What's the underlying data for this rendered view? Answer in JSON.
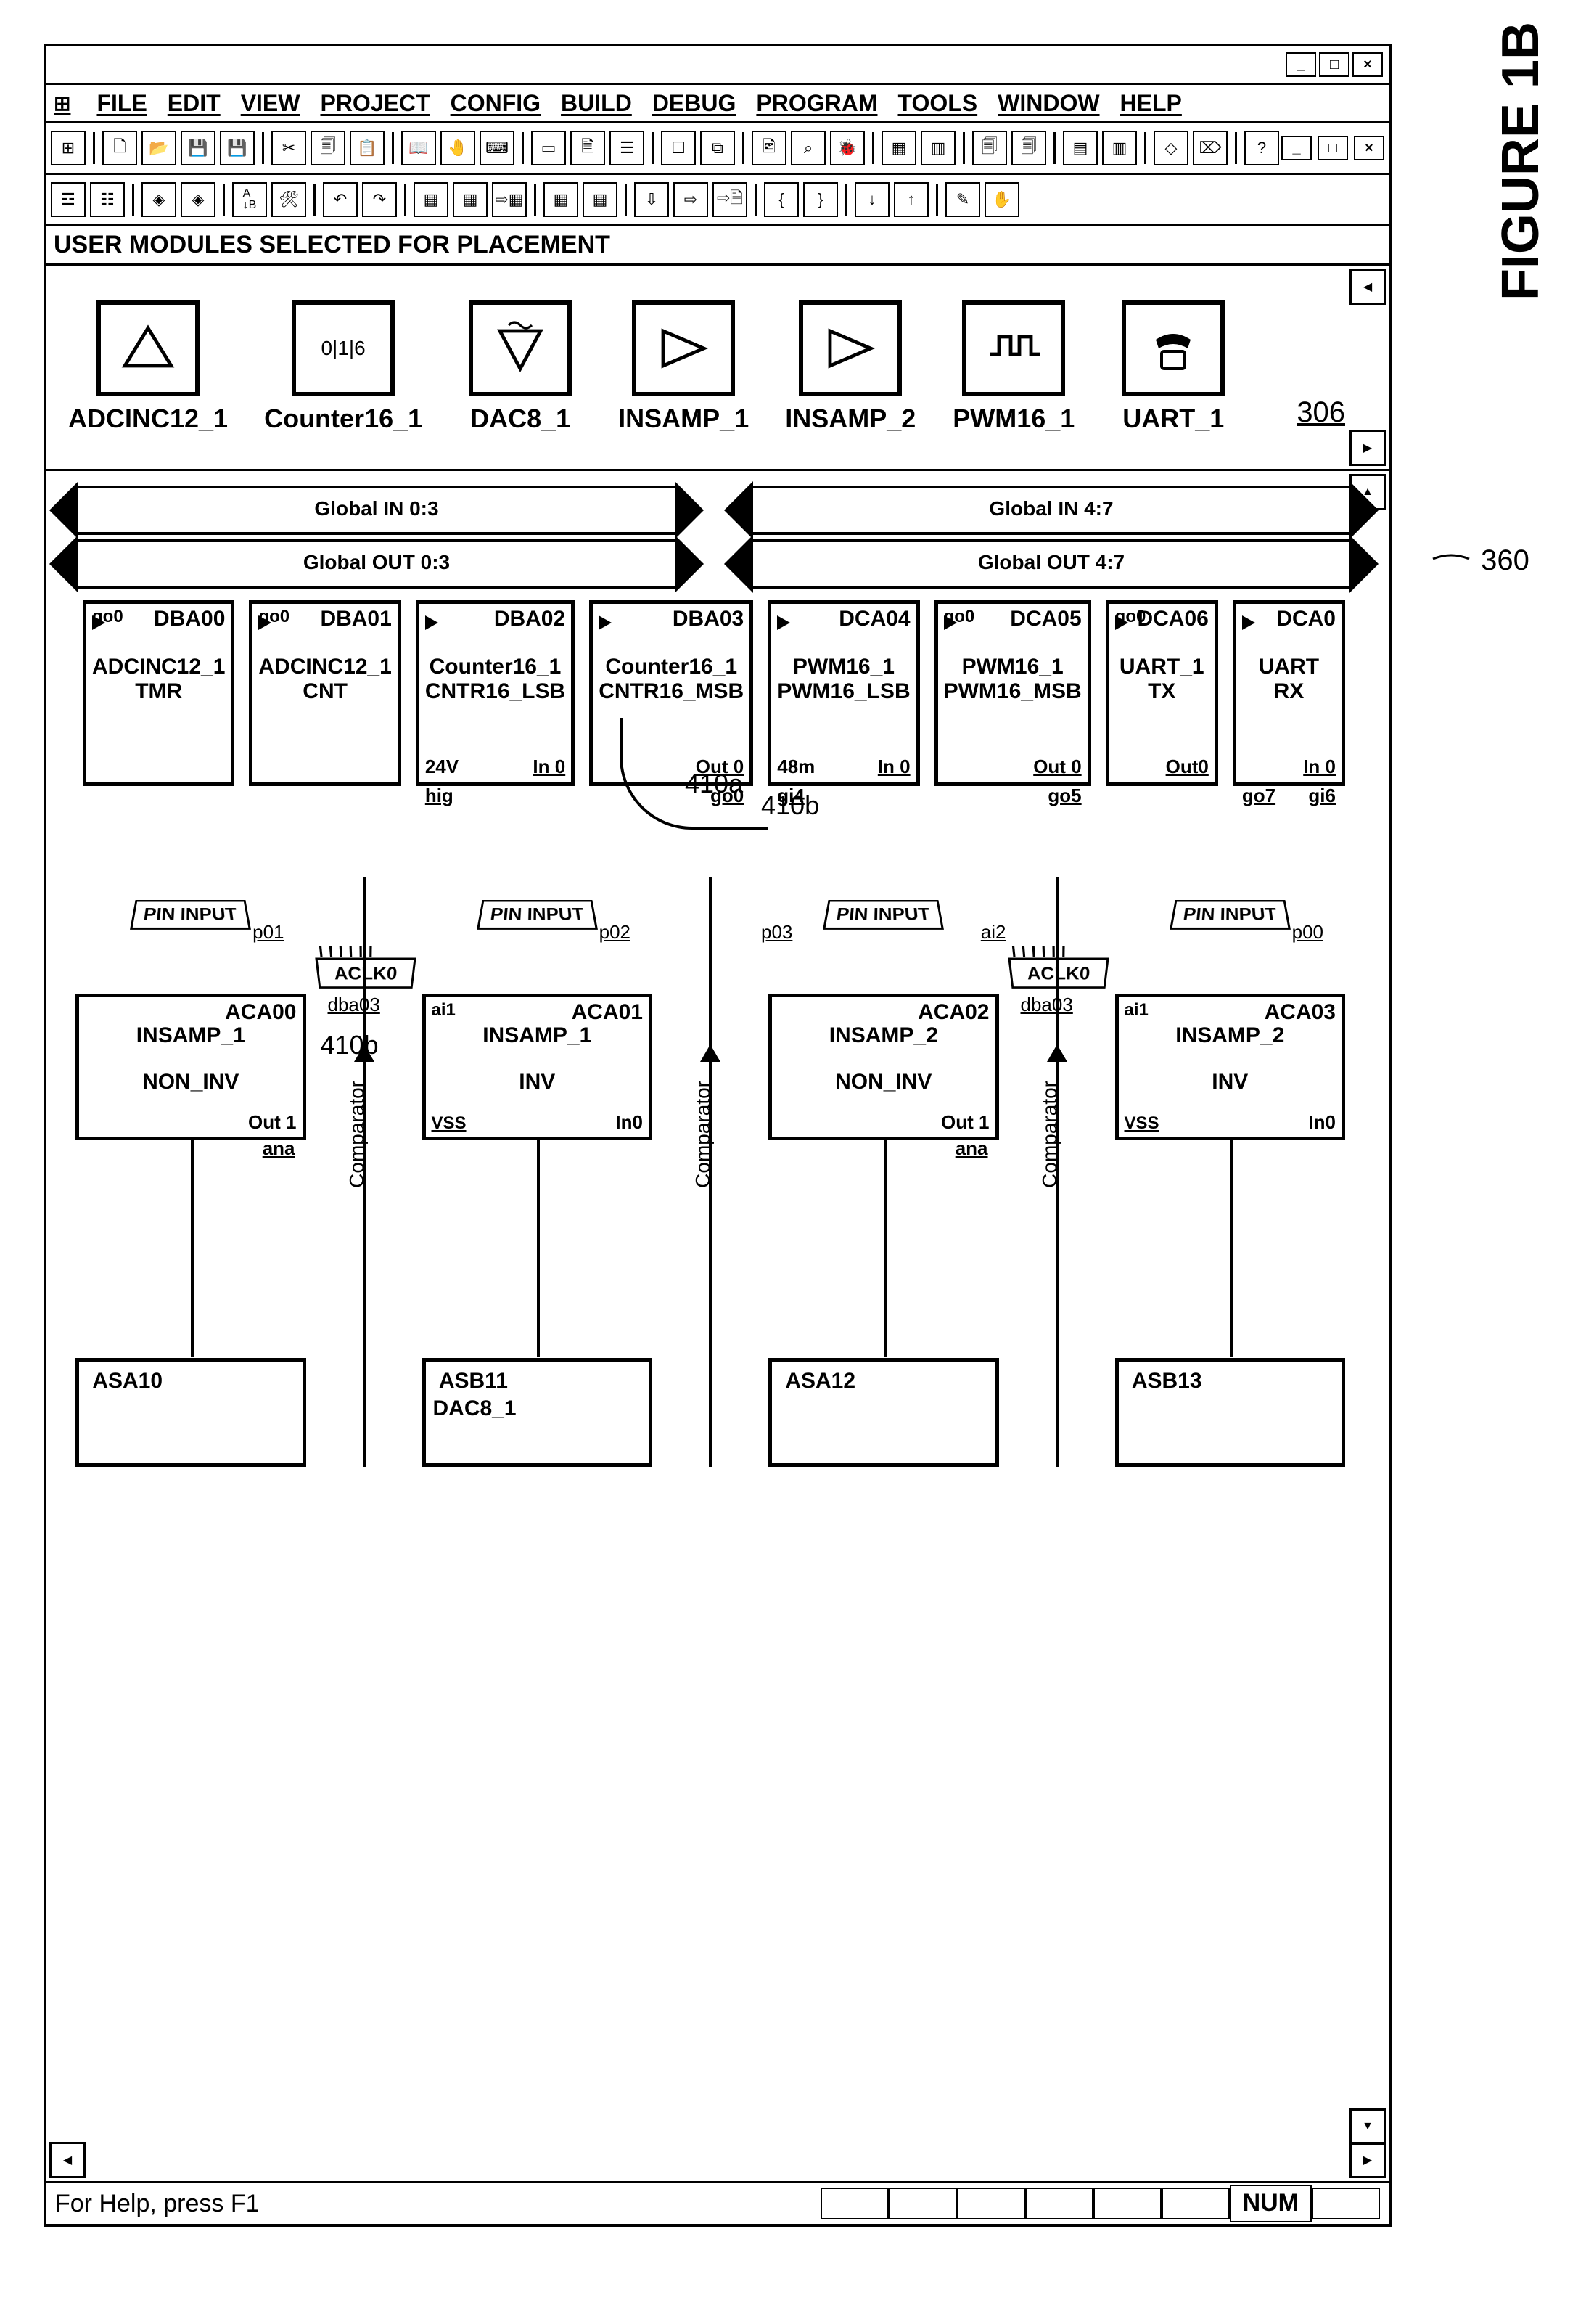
{
  "figure_label": "FIGURE 1B",
  "menubar": [
    "FILE",
    "EDIT",
    "VIEW",
    "PROJECT",
    "CONFIG",
    "BUILD",
    "DEBUG",
    "PROGRAM",
    "TOOLS",
    "WINDOW",
    "HELP"
  ],
  "section_header": "USER MODULES SELECTED FOR PLACEMENT",
  "ref_306": "306",
  "ref_360": "360",
  "modules": [
    {
      "label": "ADCINC12_1",
      "icon": "adc"
    },
    {
      "label": "Counter16_1",
      "icon": "counter"
    },
    {
      "label": "DAC8_1",
      "icon": "dac"
    },
    {
      "label": "INSAMP_1",
      "icon": "amp"
    },
    {
      "label": "INSAMP_2",
      "icon": "amp"
    },
    {
      "label": "PWM16_1",
      "icon": "pwm"
    },
    {
      "label": "UART_1",
      "icon": "phone"
    }
  ],
  "bus_labels": {
    "gin_03": "Global IN 0:3",
    "gout_03": "Global OUT 0:3",
    "gin_47": "Global IN 4:7",
    "gout_47": "Global OUT 4:7"
  },
  "digital_blocks": [
    {
      "tl": "go0",
      "id": "DBA00",
      "l1": "ADCINC12_1",
      "l2": "TMR",
      "bl": "",
      "br": "",
      "below_l": "",
      "below_r": ""
    },
    {
      "tl": "go0",
      "id": "DBA01",
      "l1": "ADCINC12_1",
      "l2": "CNT",
      "bl": "",
      "br": "",
      "below_l": "",
      "below_r": ""
    },
    {
      "tl": "",
      "id": "DBA02",
      "l1": "Counter16_1",
      "l2": "CNTR16_LSB",
      "bl": "24V",
      "br": "In 0",
      "below_l": "hig",
      "below_r": ""
    },
    {
      "tl": "",
      "id": "DBA03",
      "l1": "Counter16_1",
      "l2": "CNTR16_MSB",
      "bl": "",
      "br": "Out 0",
      "below_l": "",
      "below_r": "go0"
    },
    {
      "tl": "",
      "id": "DCA04",
      "l1": "PWM16_1",
      "l2": "PWM16_LSB",
      "bl": "48m",
      "br": "In 0",
      "below_l": "gi4",
      "below_r": ""
    },
    {
      "tl": "go0",
      "id": "DCA05",
      "l1": "PWM16_1",
      "l2": "PWM16_MSB",
      "bl": "",
      "br": "Out 0",
      "below_l": "",
      "below_r": "go5"
    },
    {
      "tl": "go0",
      "id": "DCA06",
      "l1": "UART_1",
      "l2": "TX",
      "bl": "",
      "br": "Out0",
      "below_l": "",
      "below_r": ""
    },
    {
      "tl": "",
      "id": "DCA0",
      "l1": "UART",
      "l2": "RX",
      "bl": "",
      "br": "In 0",
      "below_l": "go7",
      "below_r": "gi6"
    }
  ],
  "ref_410a": "410a",
  "ref_410b": "410b",
  "analog_cols": [
    {
      "pin_p": "p01",
      "pin_input": "PIN INPUT",
      "aca": {
        "tl": "",
        "id": "ACA00",
        "c1": "INSAMP_1",
        "c2": "NON_INV",
        "bl": "",
        "br": "Out 1"
      },
      "bot": {
        "id": "ASA10",
        "sub": ""
      },
      "aclk": "",
      "dba": "",
      "comp": false,
      "below_br": "ana"
    },
    {
      "pin_p": "p02",
      "pin_input": "PIN INPUT",
      "aca": {
        "tl": "ai1",
        "id": "ACA01",
        "c1": "INSAMP_1",
        "c2": "INV",
        "bl": "VSS",
        "br": "In0"
      },
      "bot": {
        "id": "ASB11",
        "sub": "DAC8_1"
      },
      "aclk": "ACLK0",
      "dba": "dba03",
      "comp": true,
      "below_br": ""
    },
    {
      "pin_p": "p03",
      "pin_input": "PIN INPUT",
      "ai": "ai2",
      "aca": {
        "tl": "",
        "id": "ACA02",
        "c1": "INSAMP_2",
        "c2": "NON_INV",
        "bl": "",
        "br": "Out 1"
      },
      "bot": {
        "id": "ASA12",
        "sub": ""
      },
      "aclk": "",
      "dba": "",
      "comp": true,
      "below_br": "ana"
    },
    {
      "pin_p": "p00",
      "pin_input": "PIN INPUT",
      "aca": {
        "tl": "ai1",
        "id": "ACA03",
        "c1": "INSAMP_2",
        "c2": "INV",
        "bl": "VSS",
        "br": "In0"
      },
      "bot": {
        "id": "ASB13",
        "sub": ""
      },
      "aclk": "ACLK0",
      "dba": "dba03",
      "comp": false,
      "below_br": ""
    }
  ],
  "comparator_label": "Comparator",
  "statusbar": "For Help, press F1",
  "status_num": "NUM"
}
